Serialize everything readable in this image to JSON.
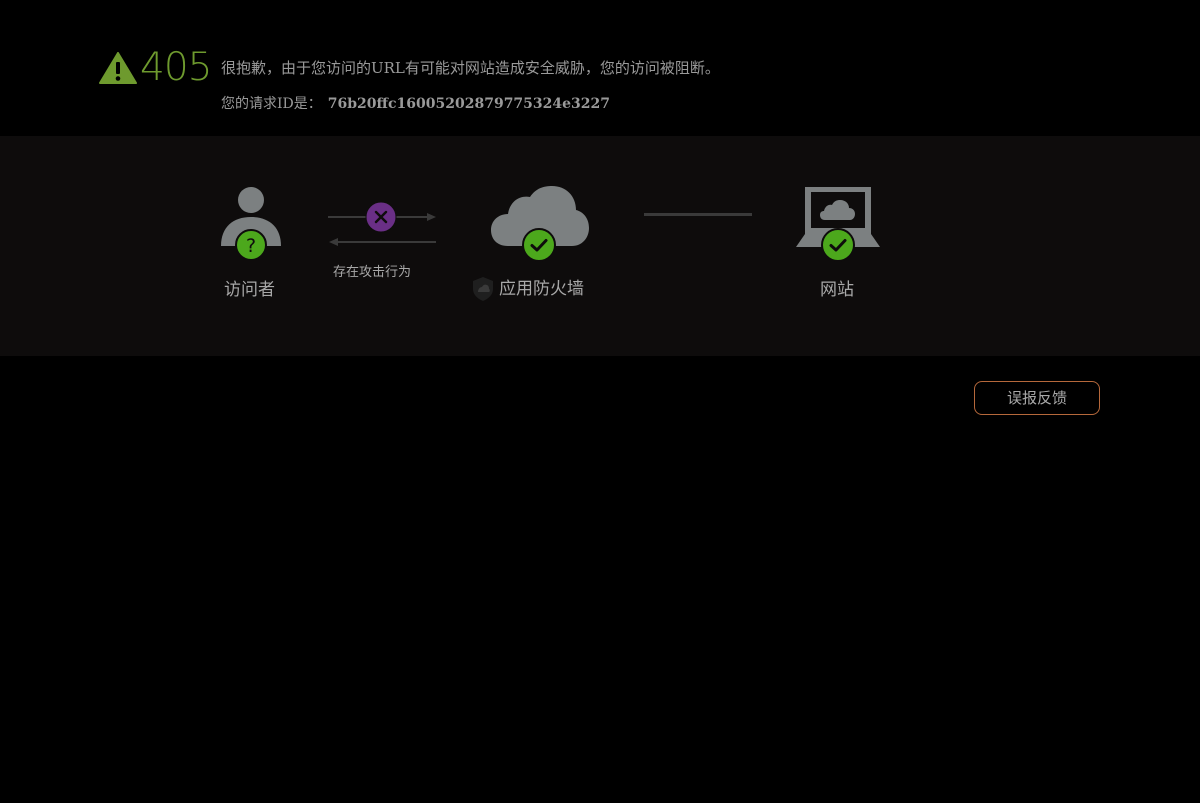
{
  "header": {
    "error_code": "405",
    "message": "很抱歉，由于您访问的URL有可能对网站造成安全威胁，您的访问被阻断。",
    "request_id_label": "您的请求ID是：",
    "request_id": "76b20ffc16005202879775324e3227"
  },
  "diagram": {
    "visitor_label": "访问者",
    "attack_label": "存在攻击行为",
    "firewall_label": "应用防火墙",
    "website_label": "网站"
  },
  "actions": {
    "feedback_label": "误报反馈"
  },
  "colors": {
    "background": "#000000",
    "band": "#0e0c0c",
    "accent_green": "#6e9a2e",
    "check_green": "#4ca81c",
    "block_purple": "#6a2f86",
    "icon_gray": "#7c8081",
    "text_gray": "#9a9a9a",
    "feedback_border": "#b5683b"
  },
  "icons": {
    "warning": "warning-triangle-icon",
    "visitor": "person-icon",
    "unknown": "question-badge-icon",
    "blocked": "x-badge-icon",
    "firewall": "cloud-icon",
    "shield": "shield-icon",
    "ok": "check-badge-icon",
    "website": "laptop-icon"
  }
}
